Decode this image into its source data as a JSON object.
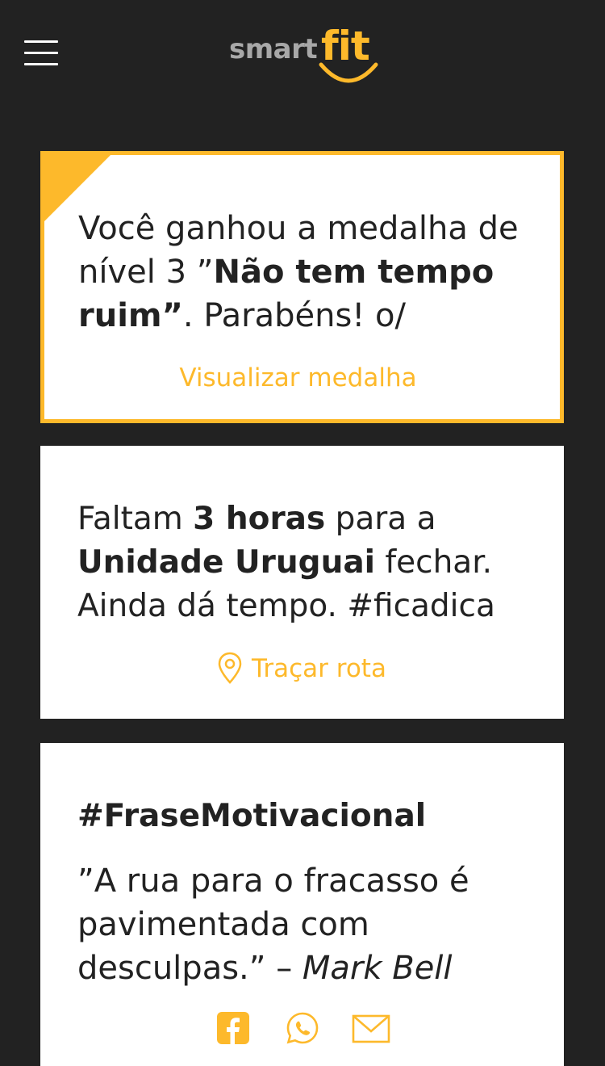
{
  "header": {
    "logo": {
      "smart": "smart",
      "fit": "fit"
    },
    "menu_icon": "hamburger-menu-icon"
  },
  "medal_card": {
    "text_before": "Você ganhou a medalha de nível 3 ”",
    "medal_name": "Não tem tempo ruim”",
    "text_after": ". Parabéns! o/",
    "action_label": "Visualizar medalha"
  },
  "hours_card": {
    "text_1": "Faltam ",
    "hours": "3 horas",
    "text_2": " para a ",
    "unit": "Unidade Uruguai",
    "text_3": " fechar. Ainda dá tempo. #ficadica",
    "action_label": "Traçar rota",
    "action_icon": "map-pin-icon"
  },
  "quote_card": {
    "heading": "#FraseMotivacional",
    "quote": "”A rua para o fracasso é pavimentada com desculpas.” – ",
    "author": "Mark Bell",
    "share_icons": [
      "facebook-icon",
      "whatsapp-icon",
      "email-icon"
    ]
  },
  "colors": {
    "accent": "#fdb92b",
    "background": "#222222",
    "card": "#ffffff",
    "text": "#222222",
    "logo_grey": "#a8a8a8"
  }
}
